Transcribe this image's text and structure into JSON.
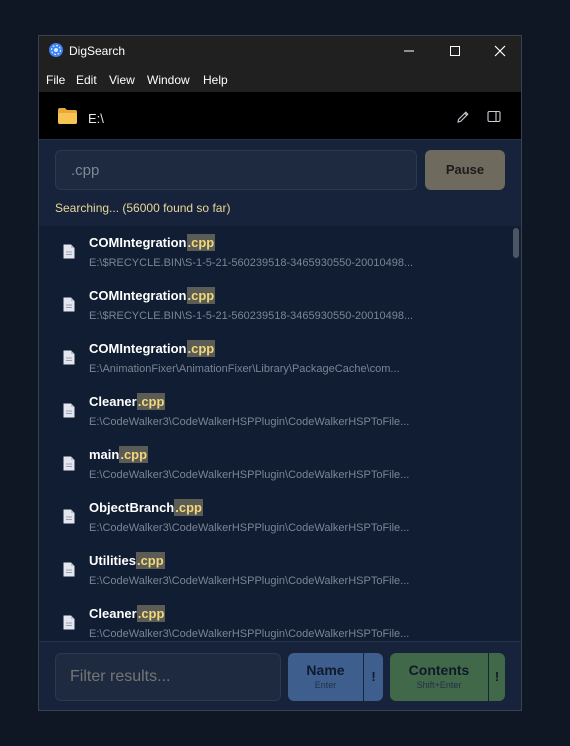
{
  "window": {
    "title": "DigSearch"
  },
  "menu": [
    "File",
    "Edit",
    "View",
    "Window",
    "Help"
  ],
  "path": {
    "text": "E:\\"
  },
  "search": {
    "value": ".cpp",
    "pause_label": "Pause"
  },
  "status": {
    "text": "Searching... (56000 found so far)"
  },
  "results": [
    {
      "stem": "COMIntegration",
      "ext": ".cpp",
      "path": "E:\\$RECYCLE.BIN\\S-1-5-21-560239518-3465930550-20010498..."
    },
    {
      "stem": "COMIntegration",
      "ext": ".cpp",
      "path": "E:\\$RECYCLE.BIN\\S-1-5-21-560239518-3465930550-20010498..."
    },
    {
      "stem": "COMIntegration",
      "ext": ".cpp",
      "path": "E:\\AnimationFixer\\AnimationFixer\\Library\\PackageCache\\com..."
    },
    {
      "stem": "Cleaner",
      "ext": ".cpp",
      "path": "E:\\CodeWalker3\\CodeWalkerHSPPlugin\\CodeWalkerHSPToFile..."
    },
    {
      "stem": "main",
      "ext": ".cpp",
      "path": "E:\\CodeWalker3\\CodeWalkerHSPPlugin\\CodeWalkerHSPToFile..."
    },
    {
      "stem": "ObjectBranch",
      "ext": ".cpp",
      "path": "E:\\CodeWalker3\\CodeWalkerHSPPlugin\\CodeWalkerHSPToFile..."
    },
    {
      "stem": "Utilities",
      "ext": ".cpp",
      "path": "E:\\CodeWalker3\\CodeWalkerHSPPlugin\\CodeWalkerHSPToFile..."
    },
    {
      "stem": "Cleaner",
      "ext": ".cpp",
      "path": "E:\\CodeWalker3\\CodeWalkerHSPPlugin\\CodeWalkerHSPToFile..."
    }
  ],
  "filter": {
    "placeholder": "Filter results..."
  },
  "buttons": {
    "name": {
      "label": "Name",
      "sub": "Enter",
      "extra": "!"
    },
    "contents": {
      "label": "Contents",
      "sub": "Shift+Enter",
      "extra": "!"
    }
  },
  "colors": {
    "highlight_text": "#f3d779",
    "highlight_bg": "#5a5c55",
    "status": "#e8d79a",
    "name_button": "#3e5e8e",
    "contents_button": "#416849",
    "pause_button": "#6e6a5e"
  }
}
